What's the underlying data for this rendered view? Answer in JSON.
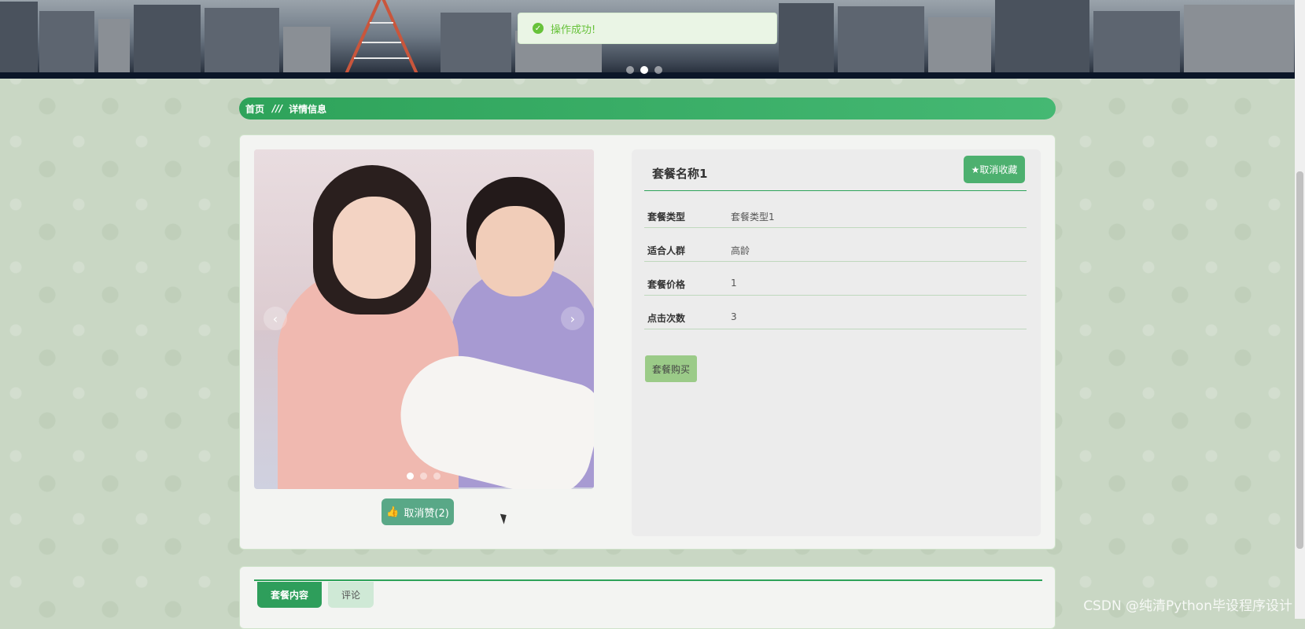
{
  "toast": {
    "icon": "check-circle-icon",
    "message": "操作成功!"
  },
  "breadcrumb": {
    "home": "首页",
    "separator": "///",
    "current": "详情信息"
  },
  "detail": {
    "title": "套餐名称1",
    "favorite_label": "取消收藏",
    "favorite_icon": "star-icon",
    "fields": [
      {
        "label": "套餐类型",
        "value": "套餐类型1"
      },
      {
        "label": "适合人群",
        "value": "高龄"
      },
      {
        "label": "套餐价格",
        "value": "1"
      },
      {
        "label": "点击次数",
        "value": "3"
      }
    ],
    "buy_label": "套餐购买"
  },
  "gallery": {
    "prev_icon": "chevron-left-icon",
    "next_icon": "chevron-right-icon",
    "slides": 3,
    "active": 1
  },
  "like_button": {
    "icon": "thumbs-up-icon",
    "label": "取消赞(2)"
  },
  "tabs": [
    {
      "label": "套餐内容",
      "active": true
    },
    {
      "label": "评论",
      "active": false
    }
  ],
  "watermark": "CSDN @纯清Python毕设程序设计",
  "colors": {
    "primary": "#2ea35a",
    "success": "#67c23a",
    "buy": "#9bcb88",
    "like": "#59a887"
  }
}
